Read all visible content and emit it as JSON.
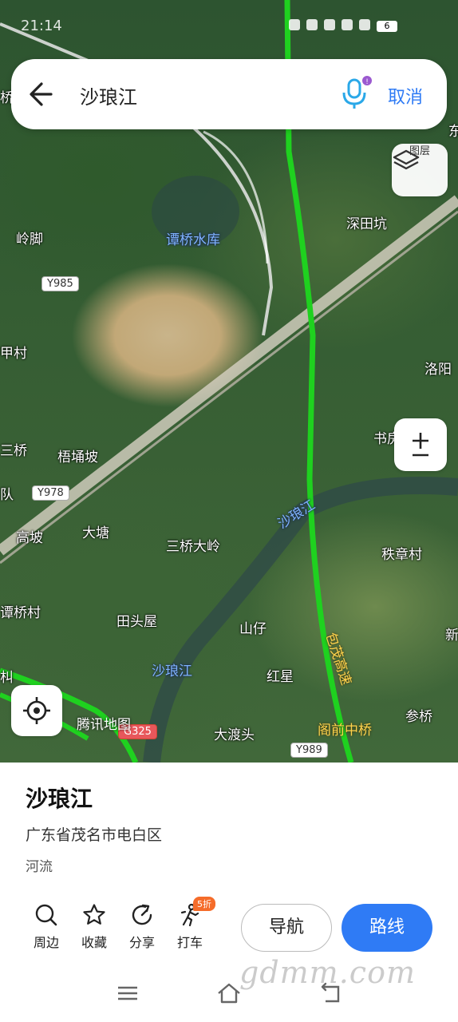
{
  "status_bar": {
    "time": "21:14",
    "battery": "6"
  },
  "search": {
    "query": "沙琅江",
    "cancel_label": "取消"
  },
  "map": {
    "layers_label": "图层",
    "watermark": "腾讯地图",
    "places": [
      "谭桥水库",
      "岭脚",
      "深田坑",
      "洛阳",
      "甲村",
      "梧埇坡",
      "书房",
      "三桥",
      "高坡",
      "大塘",
      "三桥大岭",
      "秩章村",
      "谭桥村",
      "田头屋",
      "山仔",
      "红星",
      "新",
      "大渡头",
      "参桥",
      "朻"
    ],
    "rivers": [
      "沙琅江",
      "沙琅江"
    ],
    "highway": [
      "包茂高速",
      "阁前中桥"
    ],
    "road_shields": [
      "Y985",
      "Y978",
      "G325",
      "Y989"
    ],
    "edge_labels": [
      "东",
      "队",
      "桥"
    ]
  },
  "place": {
    "name": "沙琅江",
    "address": "广东省茂名市电白区",
    "type": "河流"
  },
  "actions": [
    {
      "label": "周边",
      "icon": "search-icon"
    },
    {
      "label": "收藏",
      "icon": "star-icon"
    },
    {
      "label": "分享",
      "icon": "share-icon"
    },
    {
      "label": "打车",
      "icon": "taxi-icon",
      "badge": "5折"
    }
  ],
  "buttons": {
    "navigate": "导航",
    "route": "路线"
  },
  "site_watermark": "gdmm.com"
}
